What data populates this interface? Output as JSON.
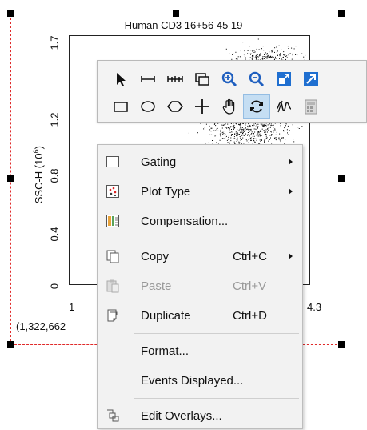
{
  "plot": {
    "title": "Human CD3 16+56 45 19",
    "y_axis_label": "SSC-H (10",
    "y_axis_exp": "6",
    "y_axis_close": ")",
    "y_ticks": [
      "0",
      "0.4",
      "0.8",
      "1.2",
      "1.7"
    ],
    "x_tick_left": "1",
    "x_tick_right": "4.3",
    "coordinate_readout": "(1,322,662"
  },
  "toolbar": {
    "row1": [
      {
        "name": "pointer-icon",
        "active": true
      },
      {
        "name": "horizontal-range-icon",
        "active": false
      },
      {
        "name": "multi-range-icon",
        "active": false
      },
      {
        "name": "overlay-windows-icon",
        "active": false
      },
      {
        "name": "zoom-in-icon",
        "active": false
      },
      {
        "name": "zoom-out-icon",
        "active": false
      },
      {
        "name": "fit-to-window-icon",
        "active": false
      },
      {
        "name": "expand-icon",
        "active": false
      }
    ],
    "row2": [
      {
        "name": "rectangle-gate-icon",
        "active": false
      },
      {
        "name": "ellipse-gate-icon",
        "active": false
      },
      {
        "name": "polygon-gate-icon",
        "active": false
      },
      {
        "name": "quadrant-gate-icon",
        "active": false
      },
      {
        "name": "pan-hand-icon",
        "active": false
      },
      {
        "name": "refresh-icon",
        "active": true
      },
      {
        "name": "histogram-tool-icon",
        "active": false
      },
      {
        "name": "calculator-icon",
        "active": false
      }
    ]
  },
  "context_menu": {
    "items": [
      {
        "label": "Gating",
        "shortcut": "",
        "submenu": true,
        "disabled": false,
        "icon": "gating-icon"
      },
      {
        "label": "Plot Type",
        "shortcut": "",
        "submenu": true,
        "disabled": false,
        "icon": "plot-type-icon"
      },
      {
        "label": "Compensation...",
        "shortcut": "",
        "submenu": false,
        "disabled": false,
        "icon": "compensation-icon"
      },
      {
        "label": "Copy",
        "shortcut": "Ctrl+C",
        "submenu": true,
        "disabled": false,
        "icon": "copy-icon"
      },
      {
        "label": "Paste",
        "shortcut": "Ctrl+V",
        "submenu": false,
        "disabled": true,
        "icon": "paste-icon"
      },
      {
        "label": "Duplicate",
        "shortcut": "Ctrl+D",
        "submenu": false,
        "disabled": false,
        "icon": "duplicate-icon"
      },
      {
        "label": "Format...",
        "shortcut": "",
        "submenu": false,
        "disabled": false,
        "icon": ""
      },
      {
        "label": "Events Displayed...",
        "shortcut": "",
        "submenu": false,
        "disabled": false,
        "icon": ""
      },
      {
        "label": "Edit Overlays...",
        "shortcut": "",
        "submenu": false,
        "disabled": false,
        "icon": "edit-overlays-icon"
      }
    ]
  },
  "colors": {
    "selection_frame": "#e02a2a",
    "active_tool": "#c5def3",
    "tool_blue": "#1f5fbf"
  }
}
